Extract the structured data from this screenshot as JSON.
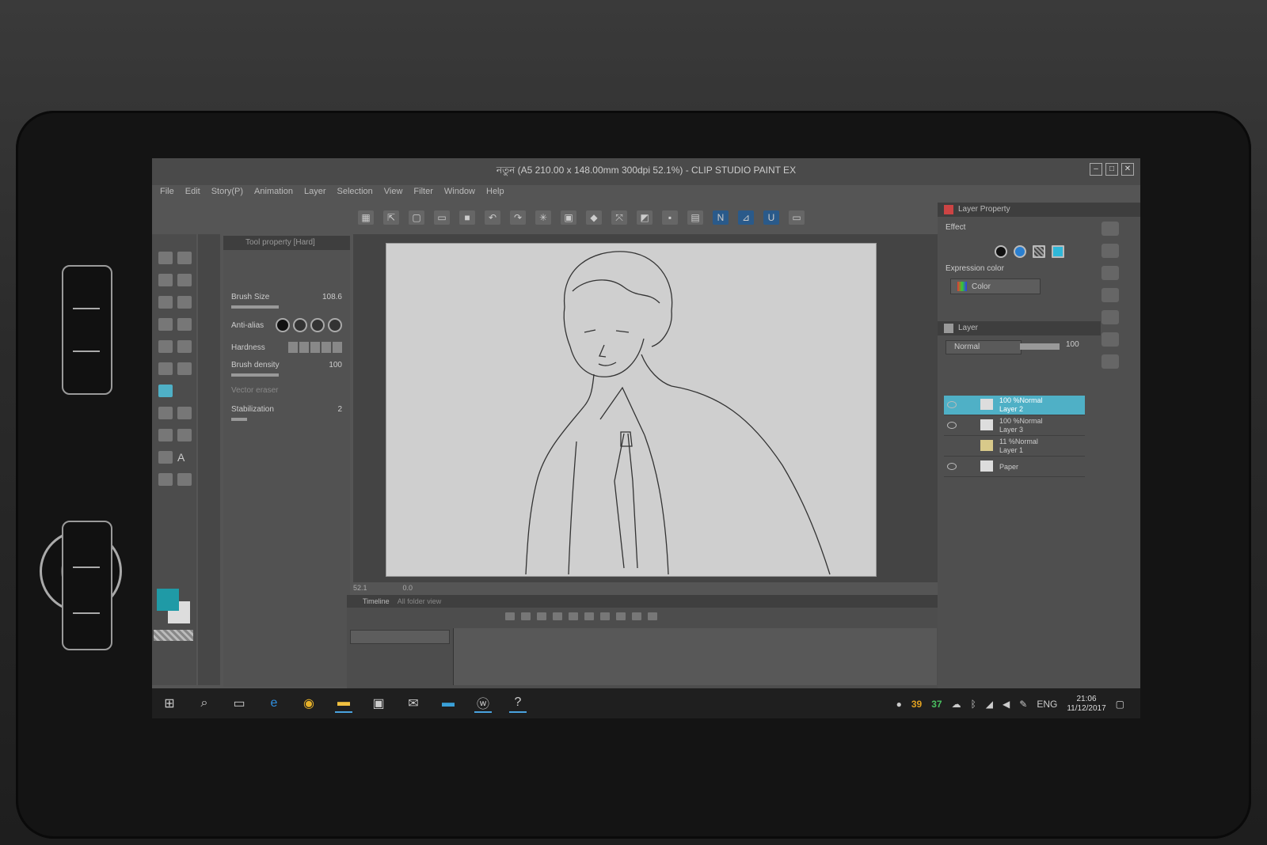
{
  "window": {
    "title": "নতুন (A5 210.00 x 148.00mm 300dpi 52.1%) - CLIP STUDIO PAINT EX"
  },
  "menu": [
    "File",
    "Edit",
    "Story(P)",
    "Animation",
    "Layer",
    "Selection",
    "View",
    "Filter",
    "Window",
    "Help"
  ],
  "tool_property": {
    "header": "Tool property [Hard]",
    "brush_size_label": "Brush Size",
    "brush_size_value": "108.6",
    "antialias_label": "Anti-alias",
    "hardness_label": "Hardness",
    "brush_density_label": "Brush density",
    "brush_density_value": "100",
    "vector_eraser_label": "Vector eraser",
    "stabilization_label": "Stabilization",
    "stabilization_value": "2"
  },
  "canvas": {
    "zoom": "52.1",
    "angle": "0.0"
  },
  "timeline": {
    "tab_label": "Timeline",
    "tab2_label": "All folder view"
  },
  "layer_property": {
    "header": "Layer Property",
    "effect_label": "Effect",
    "expression_color_label": "Expression color",
    "expression_color_value": "Color"
  },
  "layer_panel": {
    "header": "Layer",
    "blend_mode": "Normal",
    "opacity": "100",
    "layers": [
      {
        "info": "100 %Normal",
        "name": "Layer 2",
        "selected": true
      },
      {
        "info": "100 %Normal",
        "name": "Layer 3",
        "selected": false
      },
      {
        "info": "11 %Normal",
        "name": "Layer 1",
        "selected": false
      },
      {
        "info": "",
        "name": "Paper",
        "selected": false
      }
    ]
  },
  "taskbar": {
    "tray_num1": "39",
    "tray_num2": "37",
    "language": "ENG",
    "time": "21:06",
    "date": "11/12/2017"
  },
  "colors": {
    "main_color": "#1f9aa6",
    "sub_color": "#dddddd",
    "selection_accent": "#4fb0c6"
  }
}
